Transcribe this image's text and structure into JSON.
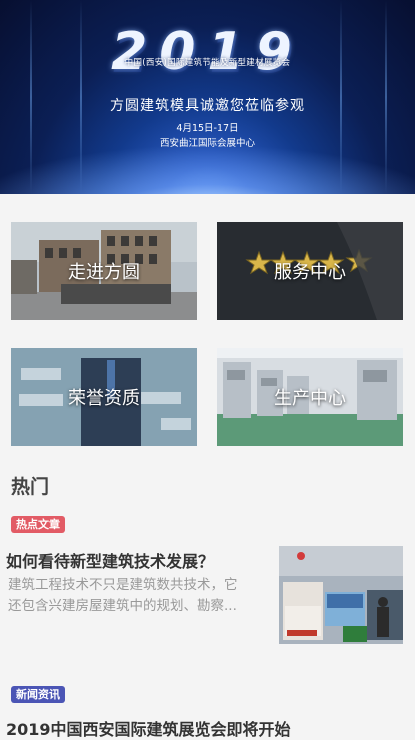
{
  "banner": {
    "year": "2019",
    "subtitle": "中国(西安)国际建筑节能及新型建材展览会",
    "invite": "方圆建筑模具诚邀您莅临参观",
    "date": "4月15日-17日",
    "venue": "西安曲江国际会展中心"
  },
  "tiles": [
    {
      "label": "走进方圆"
    },
    {
      "label": "服务中心"
    },
    {
      "label": "荣誉资质"
    },
    {
      "label": "生产中心"
    }
  ],
  "hot_section": {
    "title": "热门"
  },
  "articles": [
    {
      "badge": "热点文章",
      "title": "如何看待新型建筑技术发展？",
      "excerpt_line1": "建筑工程技术不只是建筑数共技术，它",
      "excerpt_line2": "还包含兴建房屋建筑中的规划、勘察..."
    },
    {
      "badge": "新闻资讯",
      "title": "2019中国西安国际建筑展览会即将开始"
    }
  ]
}
